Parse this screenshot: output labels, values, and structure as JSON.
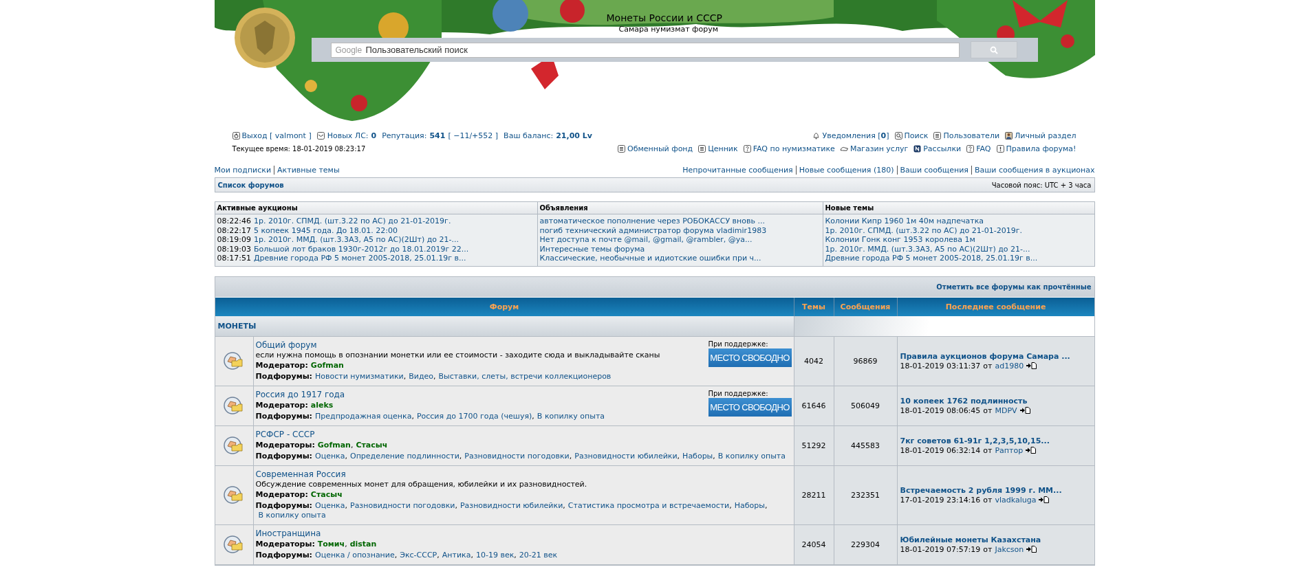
{
  "header": {
    "title": "Монеты России и СССР",
    "subtitle": "Самара нумизмат форум",
    "search": {
      "brand": "Google",
      "placeholder": "Пользовательский поиск"
    }
  },
  "user_bar": {
    "logout": "Выход [ valmont ]",
    "stats": [
      {
        "label": "Новых ЛС:",
        "value": "0"
      },
      {
        "label": "Репутация:",
        "value": "541",
        "extra": "[ −11/+552 ]"
      },
      {
        "label": "Ваш баланс:",
        "value": "21,00 Lv"
      }
    ],
    "time": "Текущее время: 18-01-2019 08:23:17",
    "links_top": [
      "Уведомления [**0**]",
      "Поиск",
      "Пользователи",
      "Личный раздел"
    ],
    "links_bottom": [
      "Обменный фонд",
      "Ценник",
      "FAQ по нумизматике",
      "Магазин услуг",
      "Рассылки",
      "FAQ",
      "Правила форума!"
    ]
  },
  "subnav": {
    "left": [
      "Мои подписки",
      "Активные темы"
    ],
    "right": [
      "Непрочитанные сообщения",
      "Новые сообщения (180)",
      "Ваши сообщения",
      "Ваши сообщения в аукционах"
    ]
  },
  "breadcrumb": {
    "label": "Список форумов",
    "timezone": "Часовой пояс: UTC + 3 часа"
  },
  "info_panels": [
    {
      "title": "Активные аукционы",
      "items": [
        {
          "time": "08:22:46",
          "text": "1р. 2010г. СПМД. (шт.3.22 по АС) до 21-01-2019г."
        },
        {
          "time": "08:22:17",
          "text": "5 копеек 1945 года. До 18.01. 22:00"
        },
        {
          "time": "08:19:09",
          "text": "1р. 2010г. ММД. (шт.3.3А3, А5 по АС)(2Шт) до 21-..."
        },
        {
          "time": "08:19:03",
          "text": "Большой лот браков 1930г-2012г до 18.01.2019г 22..."
        },
        {
          "time": "08:17:51",
          "text": "Древние города РФ 5 монет 2005-2018, 25.01.19г в..."
        }
      ]
    },
    {
      "title": "Объявления",
      "items": [
        {
          "text": "автоматическое пополнение через РОБОКАССУ вновь ..."
        },
        {
          "text": "погиб технический администратор форума vladimir1983"
        },
        {
          "text": "Нет доступа к почте @mail, @gmail, @rambler, @ya..."
        },
        {
          "text": "Интересные темы форума"
        },
        {
          "text": "Классические, необычные и идиотские ошибки при ч..."
        }
      ]
    },
    {
      "title": "Новые темы",
      "items": [
        {
          "text": "Колонии Кипр 1960 1м 40м надпечатка"
        },
        {
          "text": "1р. 2010г. СПМД. (шт.3.22 по АС) до 21-01-2019г."
        },
        {
          "text": "Колонии Гонк конг 1953 королева 1м"
        },
        {
          "text": "1р. 2010г. ММД. (шт.3.3А3, А5 по АС)(2Шт) до 21-..."
        },
        {
          "text": "Древние города РФ 5 монет 2005-2018, 25.01.19г в..."
        }
      ]
    }
  ],
  "forum_table": {
    "mark_read": "Отметить все форумы как прочтённые",
    "columns": [
      "Форум",
      "Темы",
      "Сообщения",
      "Последнее сообщение"
    ],
    "category": "МОНЕТЫ",
    "separator": ",",
    "forums": [
      {
        "title": "Общий форум",
        "description": "если нужна помощь в опознании монетки или ее стоимости - заходите сюда и выкладывайте сканы",
        "moderators_label": "Модератор:",
        "moderators": [
          "Gofman"
        ],
        "subforums_label": "Подфорумы:",
        "subforums": [
          "Новости нумизматики",
          "Видео",
          "Выставки, слеты, встречи коллекционеров"
        ],
        "sponsor": {
          "label": "При поддержке:",
          "banner": "МЕСТО СВОБОДНО"
        },
        "topics": "4042",
        "posts": "96869",
        "last_post": {
          "title": "Правила аукционов форума Самара ...",
          "date": "18-01-2019 03:11:37",
          "by": "от",
          "author": "ad1980"
        }
      },
      {
        "title": "Россия до 1917 года",
        "moderators_label": "Модератор:",
        "moderators": [
          "aleks"
        ],
        "subforums_label": "Подфорумы:",
        "subforums": [
          "Предпродажная оценка",
          "Россия до 1700 года (чешуя)",
          "В копилку опыта"
        ],
        "sponsor": {
          "label": "При поддержке:",
          "banner": "МЕСТО СВОБОДНО"
        },
        "topics": "61646",
        "posts": "506049",
        "last_post": {
          "title": "10 копеек 1762 подлинность",
          "date": "18-01-2019 08:06:45",
          "by": "от",
          "author": "MDPV"
        }
      },
      {
        "title": "РСФСР - СССР",
        "moderators_label": "Модераторы:",
        "moderators": [
          "Gofman",
          "Стасыч"
        ],
        "subforums_label": "Подфорумы:",
        "subforums": [
          "Оценка",
          "Определение подлинности",
          "Разновидности погодовки",
          "Разновидности юбилейки",
          "Наборы",
          "В копилку опыта"
        ],
        "topics": "51292",
        "posts": "445583",
        "last_post": {
          "title": "7кг советов 61-91г 1,2,3,5,10,15...",
          "date": "18-01-2019 06:32:14",
          "by": "от",
          "author": "Раптор"
        }
      },
      {
        "title": "Современная Россия",
        "description": "Обсуждение современных монет для обращения, юбилейки и их разновидностей.",
        "moderators_label": "Модератор:",
        "moderators": [
          "Стасыч"
        ],
        "subforums_label": "Подфорумы:",
        "subforums": [
          "Оценка",
          "Разновидности погодовки",
          "Разновидности юбилейки",
          "Статистика просмотра и встречаемости",
          "Наборы",
          "В копилку опыта"
        ],
        "topics": "28211",
        "posts": "232351",
        "last_post": {
          "title": "Встречаемость 2 рубля 1999 г. ММ...",
          "date": "17-01-2019 23:14:16",
          "by": "от",
          "author": "vladkaluga"
        }
      },
      {
        "title": "Иностранщина",
        "moderators_label": "Модераторы:",
        "moderators": [
          "Томич",
          "distan"
        ],
        "subforums_label": "Подфорумы:",
        "subforums": [
          "Оценка / опознание",
          "Экс-СССР",
          "Антика",
          "10-19 век",
          "20-21 век"
        ],
        "topics": "24054",
        "posts": "229304",
        "last_post": {
          "title": "Юбилейные монеты Казахстана",
          "date": "18-01-2019 07:57:19",
          "by": "от",
          "author": "Jakcson"
        }
      }
    ]
  }
}
